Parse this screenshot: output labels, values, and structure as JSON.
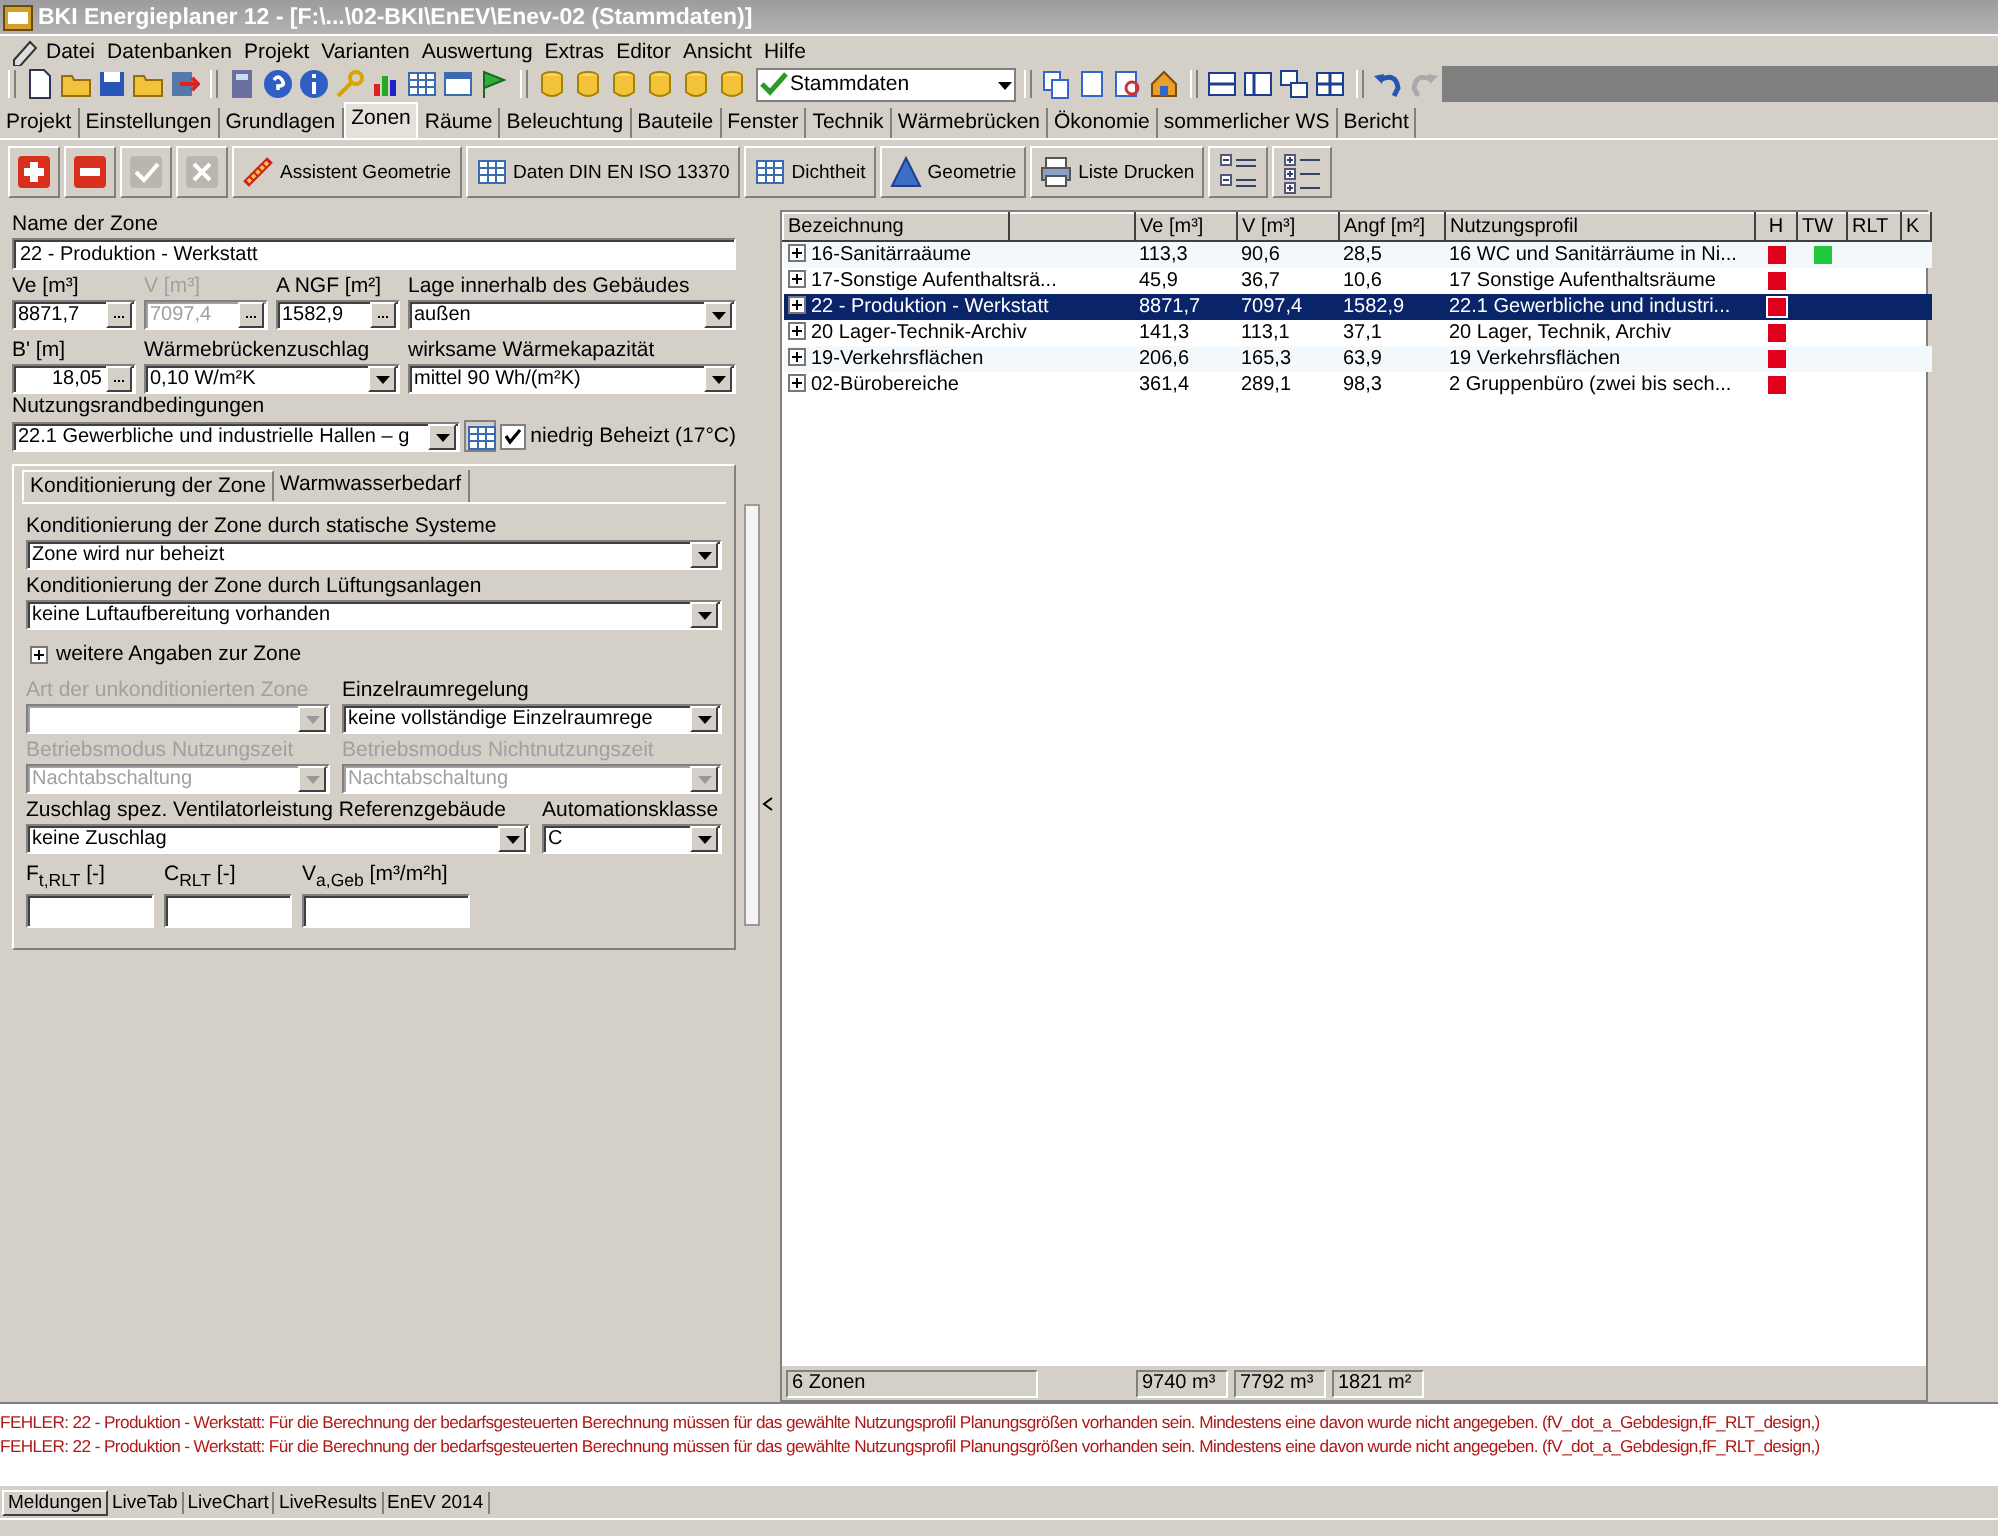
{
  "window": {
    "title": "BKI Energieplaner 12 - [F:\\...\\02-BKI\\EnEV\\Enev-02 (Stammdaten)]"
  },
  "menu": [
    "Datei",
    "Datenbanken",
    "Projekt",
    "Varianten",
    "Auswertung",
    "Extras",
    "Editor",
    "Ansicht",
    "Hilfe"
  ],
  "toolbar": {
    "dataset_combo": "Stammdaten"
  },
  "tabs": [
    {
      "label": "Projekt",
      "selected": false
    },
    {
      "label": "Einstellungen",
      "selected": false
    },
    {
      "label": "Grundlagen",
      "selected": false
    },
    {
      "label": "Zonen",
      "selected": true
    },
    {
      "label": "Räume",
      "selected": false
    },
    {
      "label": "Beleuchtung",
      "selected": false
    },
    {
      "label": "Bauteile",
      "selected": false
    },
    {
      "label": "Fenster",
      "selected": false
    },
    {
      "label": "Technik",
      "selected": false
    },
    {
      "label": "Wärmebrücken",
      "selected": false
    },
    {
      "label": "Ökonomie",
      "selected": false
    },
    {
      "label": "sommerlicher WS",
      "selected": false
    },
    {
      "label": "Bericht",
      "selected": false
    }
  ],
  "actions": [
    {
      "kind": "add",
      "disabled": false
    },
    {
      "kind": "remove",
      "disabled": false
    },
    {
      "kind": "confirm",
      "disabled": true
    },
    {
      "kind": "cancel",
      "disabled": true
    },
    {
      "kind": "text",
      "label": "Assistent Geometrie"
    },
    {
      "kind": "text",
      "label": "Daten DIN EN ISO 13370"
    },
    {
      "kind": "text",
      "label": "Dichtheit"
    },
    {
      "kind": "text",
      "label": "Geometrie"
    },
    {
      "kind": "text",
      "label": "Liste Drucken"
    },
    {
      "kind": "collapse"
    },
    {
      "kind": "expand"
    }
  ],
  "zone_form": {
    "name_label": "Name der Zone",
    "name_value": "22 - Produktion - Werkstatt",
    "fields": [
      {
        "label": "Ve [m³]",
        "value": "8871,7",
        "kind": "spin",
        "disabled": false
      },
      {
        "label": "V [m³]",
        "value": "7097,4",
        "kind": "spin",
        "disabled": true
      },
      {
        "label": "A NGF [m²]",
        "value": "1582,9",
        "kind": "spin",
        "disabled": false
      },
      {
        "label": "Lage innerhalb des Gebäudes",
        "value": "außen",
        "kind": "combo",
        "disabled": false
      },
      {
        "label": "B' [m]",
        "value": "18,05",
        "kind": "spin",
        "disabled": false
      },
      {
        "label": "Wärmebrückenzuschlag",
        "value": "0,10 W/m²K",
        "kind": "combo",
        "disabled": false
      },
      {
        "label": "wirksame Wärmekapazität",
        "value": "mittel 90 Wh/(m²K)",
        "kind": "combo",
        "disabled": false
      }
    ],
    "usage": {
      "label": "Nutzungsrandbedingungen",
      "value": "22.1 Gewerbliche und industrielle Hallen – g",
      "checkbox_label": "niedrig Beheizt (17°C)",
      "checked": true
    },
    "subtabs": [
      {
        "label": "Konditionierung der Zone",
        "selected": true
      },
      {
        "label": "Warmwasserbedarf",
        "selected": false
      }
    ],
    "conditioning": [
      [
        {
          "label": "Konditionierung der Zone durch statische Systeme",
          "value": "Zone wird nur beheizt",
          "kind": "combo",
          "disabled": false
        }
      ],
      [
        {
          "label": "Konditionierung der Zone durch Lüftungsanlagen",
          "value": "keine Luftaufbereitung vorhanden",
          "kind": "combo",
          "disabled": false
        }
      ]
    ],
    "more": {
      "label": "weitere Angaben zur Zone",
      "expanded": false
    },
    "details": [
      [
        {
          "label": "Art der unkonditionierten Zone",
          "kind": "combo",
          "disabled": true
        },
        {
          "label": "Einzelraumregelung",
          "value": "keine vollständige Einzelraumrege",
          "kind": "combo",
          "disabled": false
        }
      ],
      [
        {
          "label": "Betriebsmodus Nutzungszeit",
          "value": "Nachtabschaltung",
          "kind": "combo",
          "disabled": true
        },
        {
          "label": "Betriebsmodus Nichtnutzungszeit",
          "value": "Nachtabschaltung",
          "kind": "combo",
          "disabled": true
        }
      ],
      [
        {
          "label": "Zuschlag spez. Ventilatorleistung Referenzgebäude",
          "value": "keine Zuschlag",
          "kind": "combo",
          "disabled": false
        },
        {
          "label": "Automationsklasse",
          "value": "C",
          "kind": "combo",
          "disabled": false
        }
      ],
      [
        {
          "label": "F$_{t,RLT}$ [-]",
          "kind": "text",
          "disabled": false
        },
        {
          "label": "C$_{RLT}$ [-]",
          "kind": "text",
          "disabled": false
        },
        {
          "label": "V$_{a,Geb}$ [m³/m²h]",
          "kind": "text",
          "disabled": false
        }
      ]
    ]
  },
  "grid": {
    "columns": [
      "Bezeichnung",
      "Ve [m³]",
      "V [m³]",
      "Angf [m²]",
      "Nutzungsprofil",
      "H",
      "TW",
      "RLT",
      "K"
    ],
    "rows": [
      {
        "name": "16-Sanitärraäume",
        "ve": "113,3",
        "v": "90,6",
        "angf": "28,5",
        "profile": "16 WC und Sanitärräume in Ni...",
        "h": {
          "color": "#e0001b"
        },
        "tw": {
          "color": "#22c93a"
        },
        "selected": false
      },
      {
        "name": "17-Sonstige Aufenthaltsrä...",
        "ve": "45,9",
        "v": "36,7",
        "angf": "10,6",
        "profile": "17 Sonstige Aufenthaltsräume",
        "h": {
          "color": "#e0001b"
        },
        "selected": false
      },
      {
        "name": "22 - Produktion - Werkstatt",
        "ve": "8871,7",
        "v": "7097,4",
        "angf": "1582,9",
        "profile": "22.1 Gewerbliche und industri...",
        "h": {
          "color": "#e0001b"
        },
        "selected": true
      },
      {
        "name": "20 Lager-Technik-Archiv",
        "ve": "141,3",
        "v": "113,1",
        "angf": "37,1",
        "profile": "20 Lager, Technik, Archiv",
        "h": {
          "color": "#e0001b"
        },
        "selected": false
      },
      {
        "name": "19-Verkehrsflächen",
        "ve": "206,6",
        "v": "165,3",
        "angf": "63,9",
        "profile": "19 Verkehrsflächen",
        "h": {
          "color": "#e0001b"
        },
        "selected": false
      },
      {
        "name": "02-Bürobereiche",
        "ve": "361,4",
        "v": "289,1",
        "angf": "98,3",
        "profile": "2 Gruppenbüro (zwei bis sech...",
        "h": {
          "color": "#e0001b"
        },
        "selected": false
      }
    ],
    "footer": {
      "count": "6 Zonen",
      "ve_sum": "9740 m³",
      "v_sum": "7792 m³",
      "angf_sum": "1821 m²"
    }
  },
  "messages": [
    {
      "kind": "error",
      "text": "FEHLER: 22 - Produktion - Werkstatt: Für die Berechnung der bedarfsgesteuerten Berechnung müssen für das gewählte Nutzungsprofil Planungsgrößen vorhanden sein. Mindestens eine davon wurde nicht angegeben. (fV_dot_a_Gebdesign,fF_RLT_design,)"
    },
    {
      "kind": "error",
      "text": "FEHLER: 22 - Produktion - Werkstatt: Für die Berechnung der bedarfsgesteuerten Berechnung müssen für das gewählte Nutzungsprofil Planungsgrößen vorhanden sein. Mindestens eine davon wurde nicht angegeben. (fV_dot_a_Gebdesign,fF_RLT_design,)"
    }
  ],
  "bottom_tabs": [
    {
      "label": "Meldungen",
      "selected": true
    },
    {
      "label": "LiveTab",
      "selected": false
    },
    {
      "label": "LiveChart",
      "selected": false
    },
    {
      "label": "LiveResults",
      "selected": false
    },
    {
      "label": "EnEV 2014",
      "selected": false
    }
  ]
}
